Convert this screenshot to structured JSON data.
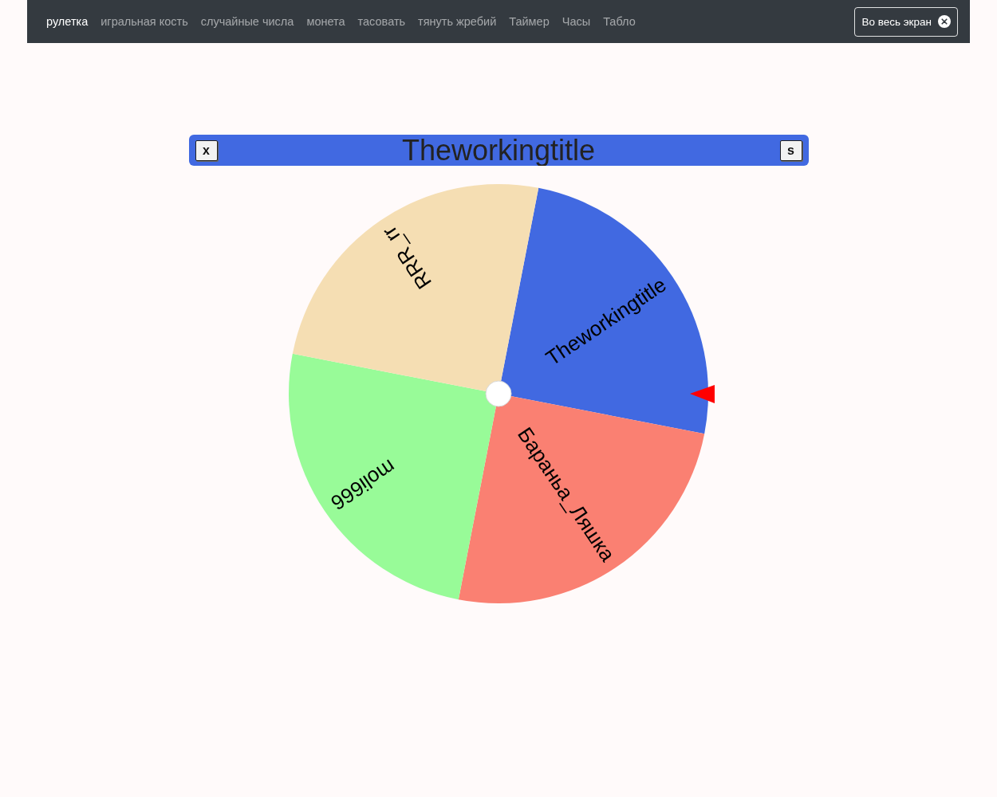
{
  "navbar": {
    "links": [
      {
        "label": "рулетка",
        "selected": true
      },
      {
        "label": "игральная кость",
        "selected": false
      },
      {
        "label": "случайные числа",
        "selected": false
      },
      {
        "label": "монета",
        "selected": false
      },
      {
        "label": "тасовать",
        "selected": false
      },
      {
        "label": "тянуть жребий",
        "selected": false
      },
      {
        "label": "Таймер",
        "selected": false
      },
      {
        "label": "Часы",
        "selected": false
      },
      {
        "label": "Табло",
        "selected": false
      }
    ],
    "fullscreen_button": {
      "label": "Во весь экран"
    }
  },
  "title_bar": {
    "left_button": {
      "label": "x"
    },
    "title": "Theworkingtitle",
    "right_button": {
      "label": "s"
    }
  },
  "wheel": {
    "segments": [
      {
        "label": "Theworkingtitle",
        "color": "#4169e1"
      },
      {
        "label": "Бараньа_Ляшка",
        "color": "#fa8072"
      },
      {
        "label": "moli666",
        "color": "#98fb98"
      },
      {
        "label": "RRR_rr",
        "color": "#f5deb3"
      }
    ]
  }
}
